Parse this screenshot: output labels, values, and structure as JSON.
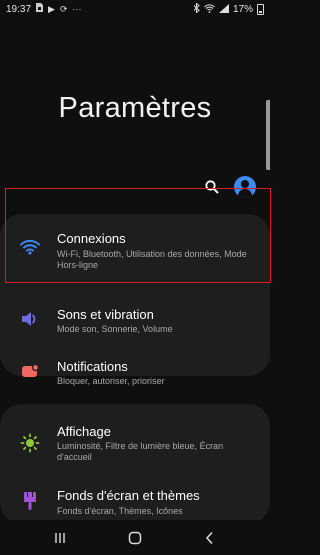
{
  "status_bar": {
    "time": "19:37",
    "left_icons": [
      "sim-icon",
      "play-icon",
      "sync-icon",
      "more-dots-icon"
    ],
    "dots": "···",
    "right_icons": [
      "bluetooth-icon",
      "wifi-icon",
      "signal-icon"
    ],
    "battery": "17%"
  },
  "page": {
    "title": "Paramètres"
  },
  "items": [
    {
      "title": "Connexions",
      "subtitle": "Wi-Fi, Bluetooth, Utilisation des données, Mode Hors-ligne",
      "icon": "wifi-icon",
      "color": "#3a88f0"
    },
    {
      "title": "Sons et vibration",
      "subtitle": "Mode son, Sonnerie, Volume",
      "icon": "volume-icon",
      "color": "#6f6ce8"
    },
    {
      "title": "Notifications",
      "subtitle": "Bloquer, autoriser, prioriser",
      "icon": "notification-icon",
      "color": "#ee6a5f"
    },
    {
      "title": "Affichage",
      "subtitle": "Luminosité, Filtre de lumière bleue, Écran d'accueil",
      "icon": "brightness-icon",
      "color": "#8fc93a"
    },
    {
      "title": "Fonds d'écran et thèmes",
      "subtitle": "Fonds d'écran, Thèmes, Icônes",
      "icon": "paintbrush-icon",
      "color": "#a155d6"
    }
  ],
  "nav": [
    "recent-apps-icon",
    "home-icon",
    "back-icon"
  ]
}
